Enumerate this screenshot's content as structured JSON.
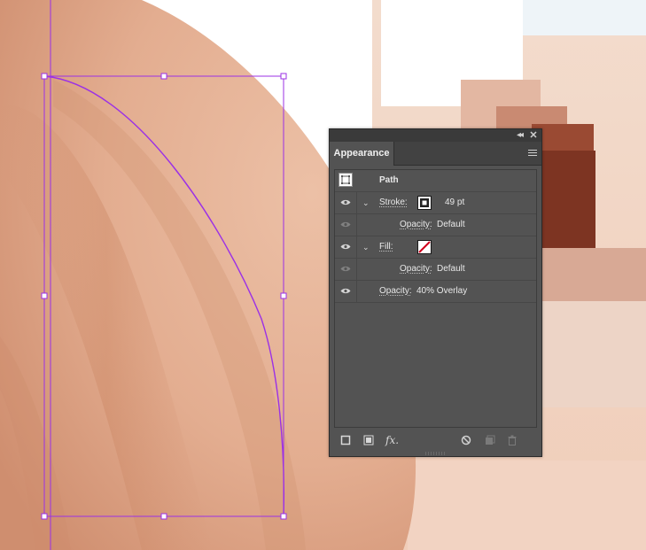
{
  "panel": {
    "title": "Appearance",
    "collapse_icon": "double-chevron-left-icon",
    "close_icon": "close-icon",
    "menu_icon": "hamburger-menu-icon",
    "object_label": "Path",
    "stroke": {
      "label": "Stroke:",
      "weight": "49 pt",
      "opacity_label": "Opacity:",
      "opacity_value": "Default"
    },
    "fill": {
      "label": "Fill:",
      "opacity_label": "Opacity:",
      "opacity_value": "Default"
    },
    "object_opacity": {
      "label": "Opacity:",
      "value": "40% Overlay"
    },
    "bottom_icons": [
      "add-new-stroke-icon",
      "add-new-fill-icon",
      "fx-icon",
      "clear-appearance-icon",
      "duplicate-item-icon",
      "delete-item-icon"
    ],
    "fx_label": "fx."
  },
  "colors": {
    "panel_bg": "#535353",
    "selection": "#9b30e6",
    "no_fill_slash": "#d0021b",
    "skin_light": "#e8b79c",
    "skin_shadow": "#c98b6d",
    "dark_accent": "#8a3a1f"
  }
}
